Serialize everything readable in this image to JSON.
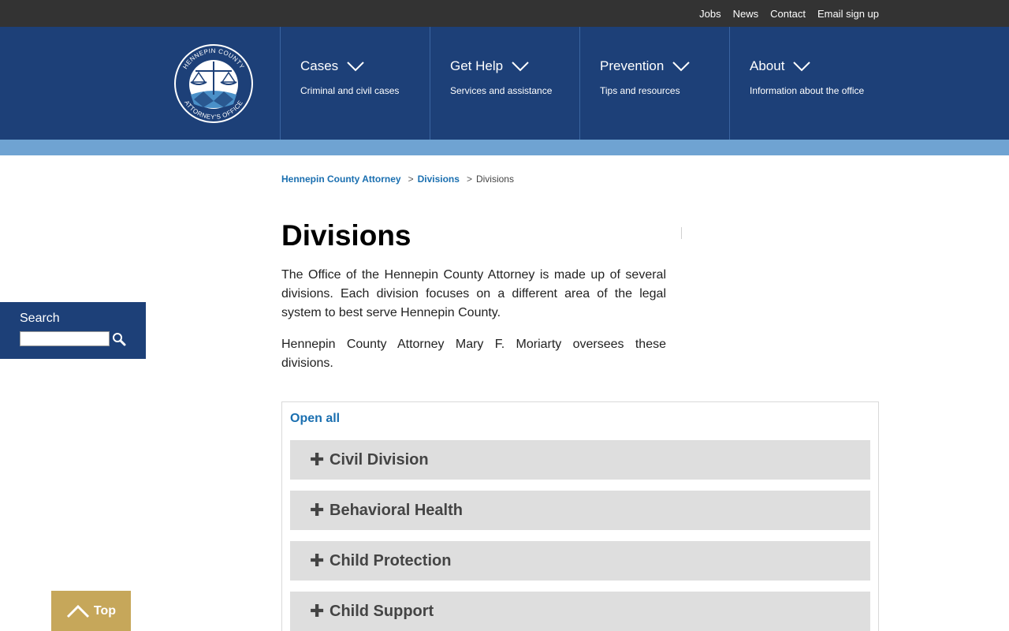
{
  "utility_nav": [
    "Jobs",
    "News",
    "Contact",
    "Email sign up"
  ],
  "logo": {
    "top_text": "HENNEPIN COUNTY",
    "bottom_text": "ATTORNEY'S OFFICE"
  },
  "main_nav": [
    {
      "title": "Cases",
      "subtitle": "Criminal and civil cases"
    },
    {
      "title": "Get Help",
      "subtitle": "Services and assistance"
    },
    {
      "title": "Prevention",
      "subtitle": "Tips and resources"
    },
    {
      "title": "About",
      "subtitle": "Information about the office"
    }
  ],
  "breadcrumb": {
    "items": [
      "Hennepin County Attorney",
      "Divisions"
    ],
    "separator": ">",
    "current": "Divisions"
  },
  "page": {
    "title": "Divisions",
    "paragraphs": [
      "The Office of the Hennepin County Attorney is made up of several divisions. Each division focuses on a different area of the legal system to best serve Hennepin County.",
      "Hennepin County Attorney Mary F. Moriarty oversees these divisions."
    ]
  },
  "accordion": {
    "open_all_label": "Open all",
    "items": [
      "Civil Division",
      "Behavioral Health",
      "Child Protection",
      "Child Support"
    ]
  },
  "search": {
    "label": "Search",
    "value": ""
  },
  "top_button": {
    "label": "Top"
  },
  "colors": {
    "utility_bar": "#333333",
    "header": "#1d4078",
    "accent_band": "#6fa3d2",
    "link": "#1a6fb0",
    "accordion_bg": "#dedede",
    "top_button": "#c6a75a"
  }
}
